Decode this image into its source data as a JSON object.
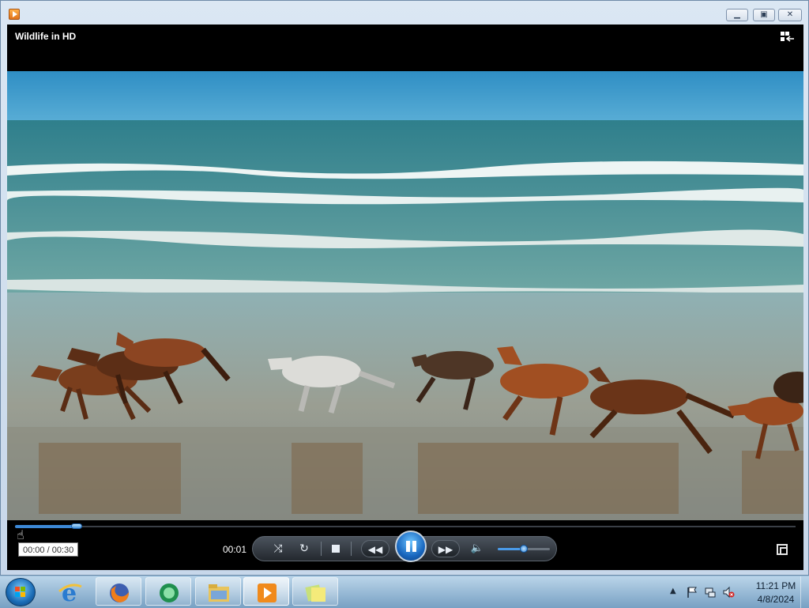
{
  "window": {
    "title_text": "",
    "controls": [
      "minimize",
      "maximize",
      "close"
    ]
  },
  "player": {
    "media_title": "Wildlife in HD",
    "tooltip_time": "00:00 / 00:30",
    "current_time": "00:01",
    "seek_progress": 0.025,
    "volume_level": 0.5,
    "state": "playing",
    "accent_color": "#3c88d6"
  },
  "icons": {
    "switch_view": "switch-to-library-icon",
    "shuffle": "shuffle-icon",
    "repeat": "repeat-icon",
    "stop": "stop-icon",
    "rewind": "rewind-icon",
    "pause": "pause-icon",
    "fast_forward": "fast-forward-icon",
    "volume": "speaker-icon",
    "fullscreen": "fullscreen-icon"
  },
  "taskbar": {
    "pinned": [
      "internet-explorer",
      "firefox",
      "media-center",
      "windows-explorer",
      "windows-media-player",
      "sticky-notes"
    ],
    "active": "windows-media-player",
    "clock_time": "11:21 PM",
    "clock_date": "4/8/2024"
  }
}
